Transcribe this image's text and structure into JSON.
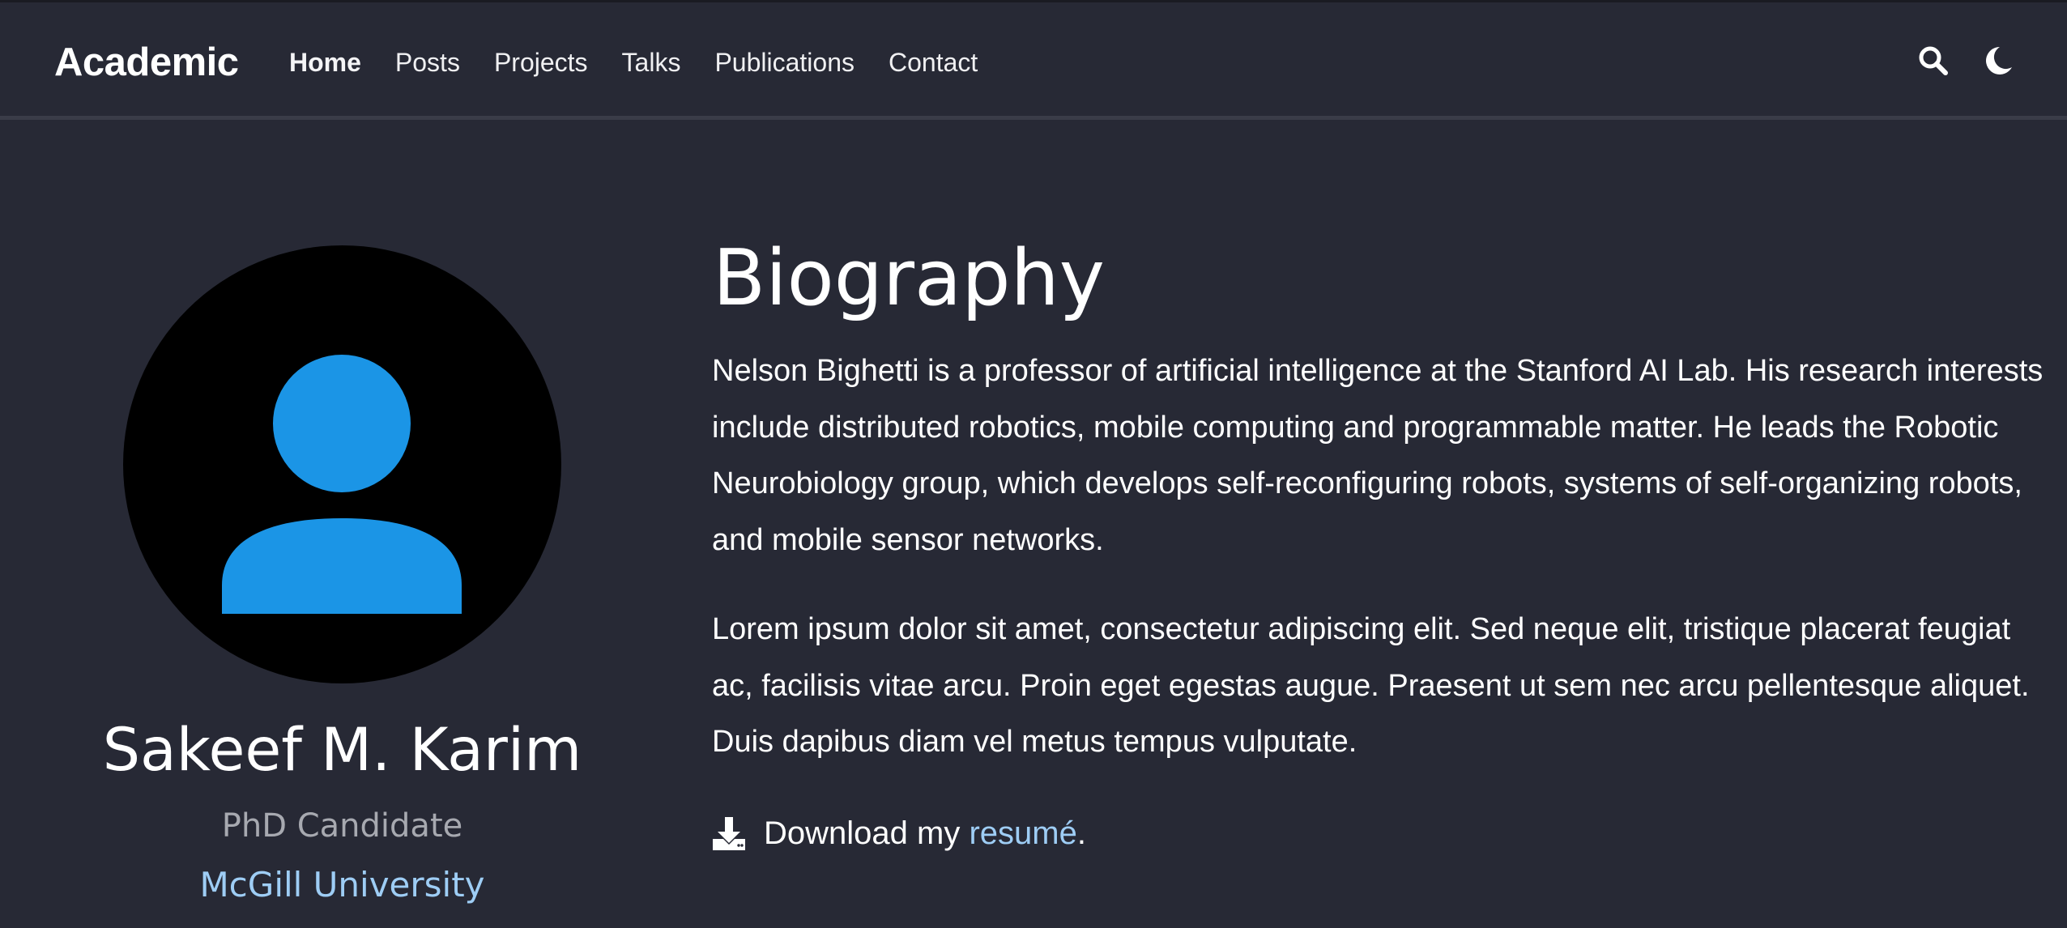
{
  "header": {
    "brand": "Academic",
    "nav": [
      {
        "label": "Home",
        "active": true
      },
      {
        "label": "Posts",
        "active": false
      },
      {
        "label": "Projects",
        "active": false
      },
      {
        "label": "Talks",
        "active": false
      },
      {
        "label": "Publications",
        "active": false
      },
      {
        "label": "Contact",
        "active": false
      }
    ],
    "icons": [
      "search-icon",
      "moon-icon"
    ]
  },
  "profile": {
    "name": "Sakeef M. Karim",
    "role": "PhD Candidate",
    "organization": "McGill University",
    "avatar_icon": "user-icon",
    "avatar_color": "#1b95e6"
  },
  "biography": {
    "title": "Biography",
    "paragraphs": [
      "Nelson Bighetti is a professor of artificial intelligence at the Stanford AI Lab. His research interests include distributed robotics, mobile computing and programmable matter. He leads the Robotic Neurobiology group, which develops self-reconfiguring robots, systems of self-organizing robots, and mobile sensor networks.",
      "Lorem ipsum dolor sit amet, consectetur adipiscing elit. Sed neque elit, tristique placerat feugiat ac, facilisis vitae arcu. Proin eget egestas augue. Praesent ut sem nec arcu pellentesque aliquet. Duis dapibus diam vel metus tempus vulputate."
    ],
    "download_prefix": "Download my ",
    "download_link": "resumé",
    "download_suffix": ".",
    "download_icon": "download-icon"
  },
  "colors": {
    "background": "#272935",
    "link": "#9ecdf5",
    "muted": "#a7a9b0"
  }
}
